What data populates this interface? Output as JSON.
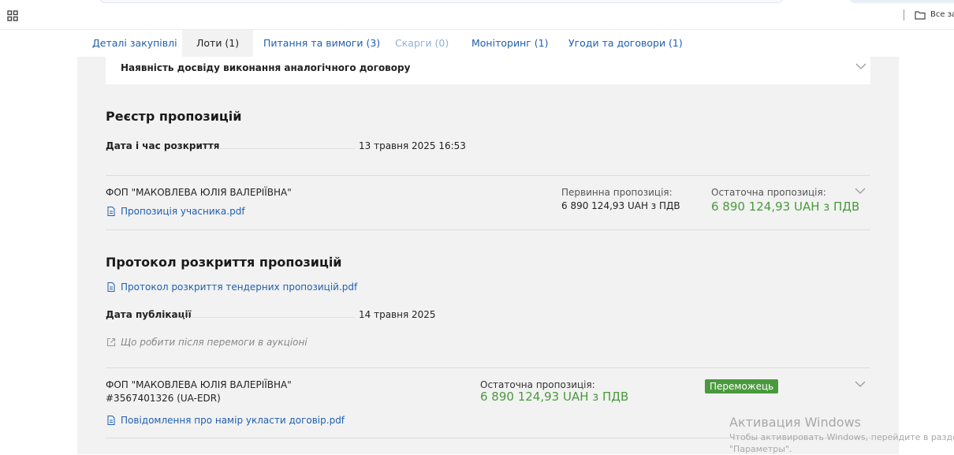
{
  "bookmarks": {
    "folder_label": "Все зак"
  },
  "tabs": [
    {
      "label": "Деталі закупівлі"
    },
    {
      "label": "Лоти (1)"
    },
    {
      "label": "Питання та вимоги (3)"
    },
    {
      "label": "Скарги (0)"
    },
    {
      "label": "Моніторинг (1)"
    },
    {
      "label": "Угоди та договори (1)"
    }
  ],
  "criteria": {
    "label": "Наявність досвіду виконання аналогічного договору"
  },
  "bids_registry": {
    "title": "Реєстр пропозицій",
    "opening_label": "Дата і час розкриття",
    "opening_value": "13 травня 2025 16:53",
    "bid": {
      "bidder": "ФОП \"МАКОВЛЕВА ЮЛІЯ ВАЛЕРІЇВНА\"",
      "document": "Пропозиція учасника.pdf",
      "initial_label": "Первинна пропозиція:",
      "initial_value": "6 890 124,93 UAH з ПДВ",
      "final_label": "Остаточна пропозиція:",
      "final_value": "6 890 124,93 UAH з ПДВ"
    }
  },
  "protocol": {
    "title": "Протокол розкриття пропозицій",
    "document": "Протокол розкриття тендерних пропозицій.pdf",
    "publication_label": "Дата публікації",
    "publication_value": "14 травня 2025",
    "hint": "Що робити після перемоги в аукціоні",
    "winner": {
      "bidder": "ФОП \"МАКОВЛЕВА ЮЛІЯ ВАЛЕРІЇВНА\"",
      "edrpou": "#3567401326 (UA-EDR)",
      "final_label": "Остаточна пропозиція:",
      "final_value": "6 890 124,93 UAH з ПДВ",
      "badge": "Переможець",
      "document": "Повідомлення про намір укласти договір.pdf"
    }
  },
  "watermark": {
    "title": "Активация Windows",
    "line1": "Чтобы активировать Windows, перейдите в раздел",
    "line2": "\"Параметры\"."
  },
  "colors": {
    "link": "#1f5fae",
    "accent_green": "#4a9a3c",
    "panel_bg": "#f2f2f2"
  }
}
